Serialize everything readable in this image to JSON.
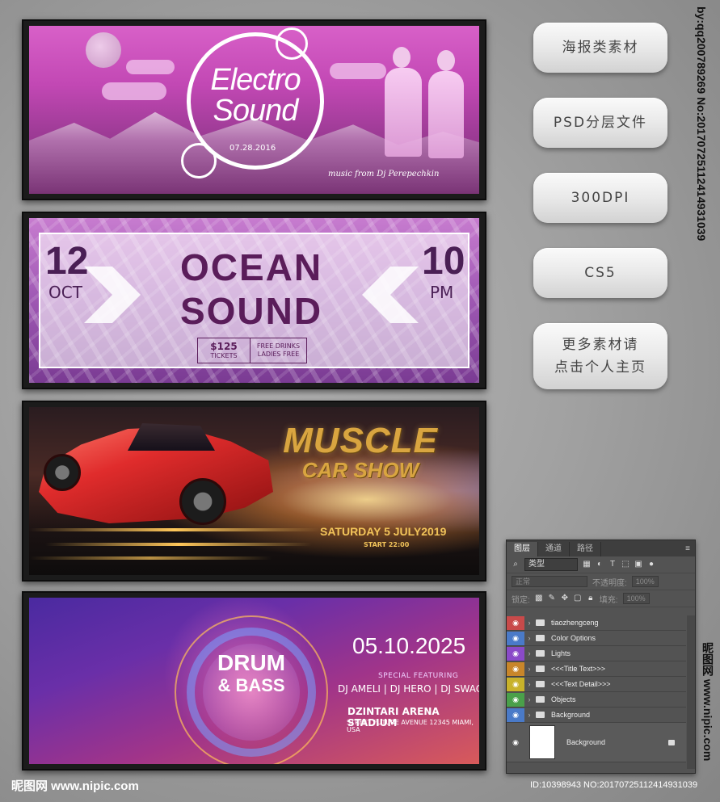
{
  "banners": {
    "electro": {
      "title_line1": "Electro",
      "title_line2": "Sound",
      "date": "07.28.2016",
      "credit": "music from Dj Perepechkin"
    },
    "ocean": {
      "day": "12",
      "month": "OCT",
      "hour": "10",
      "ampm": "PM",
      "title_line1": "OCEAN",
      "title_line2": "SOUND",
      "price": "$125",
      "price_label": "TICKETS",
      "extras_line1": "FREE DRINKS",
      "extras_line2": "LADIES FREE"
    },
    "muscle": {
      "title_line1": "MUSCLE",
      "title_line2": "CAR SHOW",
      "date": "SATURDAY 5 JULY2019",
      "start": "START 22:00"
    },
    "drum": {
      "title_line1": "DRUM",
      "title_line2": "& BASS",
      "date": "05.10.2025",
      "special": "SPECIAL FEATURING",
      "djs": "DJ AMELI | DJ HERO | DJ SWAC",
      "venue": "DZINTARI ARENA STADIUM",
      "street": "STREET FUTURE AVENUE 12345 MIAMI, USA"
    }
  },
  "pills": [
    "海报类素材",
    "PSD分层文件",
    "300DPI",
    "CS5",
    "更多素材请\n点击个人主页"
  ],
  "side_text": "by:qq20078926​9 No:20170725112414931039",
  "side_text_bottom": "昵图网 www.nipic.com",
  "ps_panel": {
    "tabs": [
      "图层",
      "通道",
      "路径"
    ],
    "filter_label": "类型",
    "blend_mode": "正常",
    "opacity_label": "不透明度:",
    "opacity_value": "100%",
    "lock_label": "锁定:",
    "fill_label": "填充:",
    "fill_value": "100%",
    "layers": [
      {
        "name": "tiaozhengceng",
        "color": "#c84a4a"
      },
      {
        "name": "Color Options",
        "color": "#4a7ac8"
      },
      {
        "name": "Lights",
        "color": "#8a4ac8"
      },
      {
        "name": "<<<Title Text>>>",
        "color": "#c8862a"
      },
      {
        "name": "<<<Text Detail>>>",
        "color": "#c8b22a"
      },
      {
        "name": "Objects",
        "color": "#4aa04a"
      },
      {
        "name": "Background",
        "color": "#4a7ac8"
      }
    ],
    "bg_layer": "Background"
  },
  "footer": {
    "left": "昵图网 www.nipic.com",
    "right": "ID:10398943 NO:20170725112414931039"
  }
}
